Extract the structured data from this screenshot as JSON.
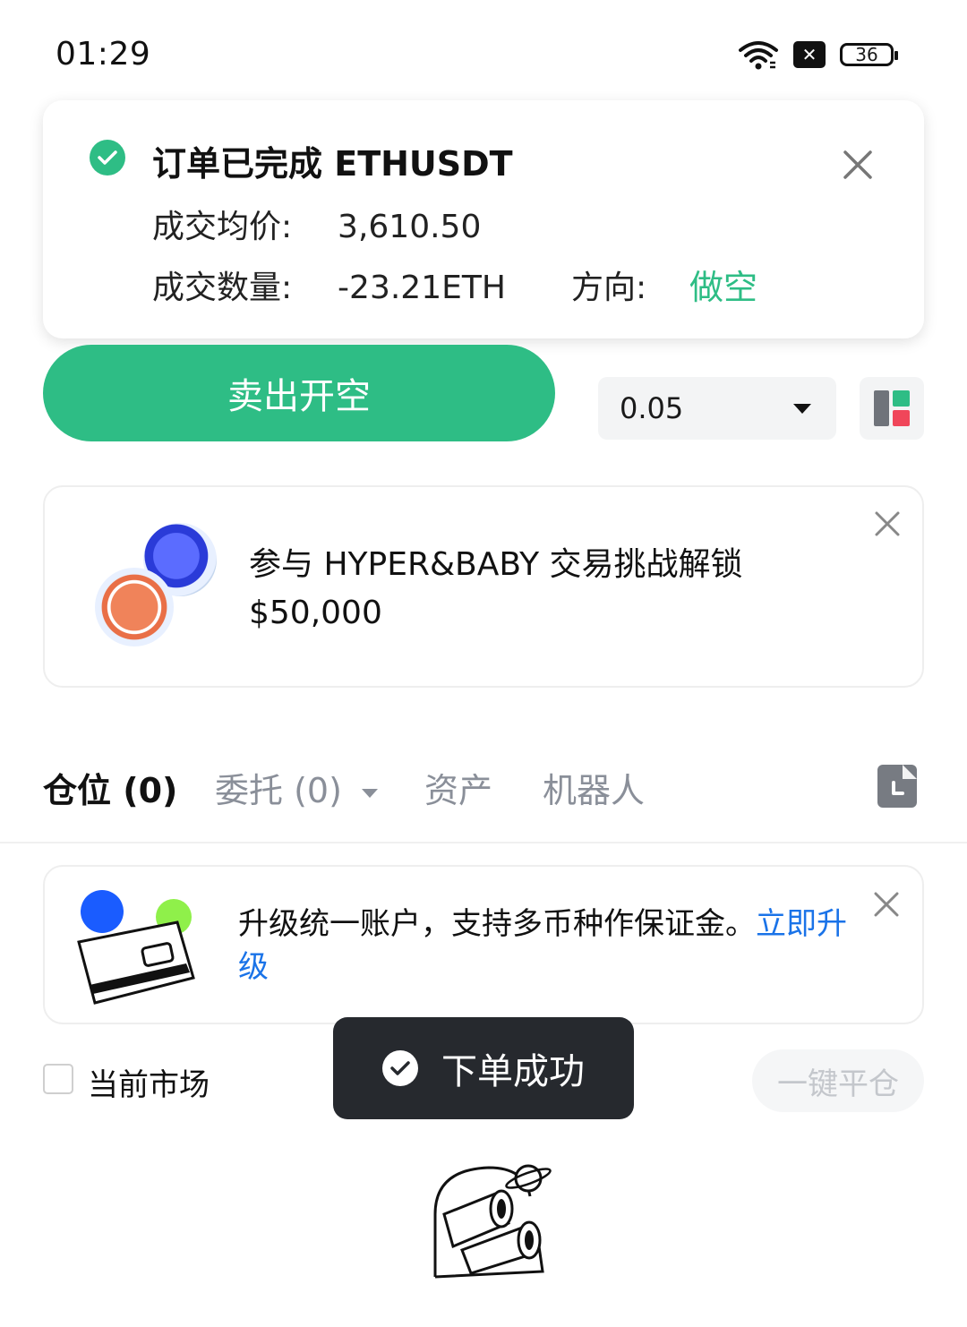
{
  "status_bar": {
    "time": "01:29",
    "battery": "36"
  },
  "order_toast": {
    "title": "订单已完成 ETHUSDT",
    "avg_price_label": "成交均价:",
    "avg_price": "3,610.50",
    "qty_label": "成交数量:",
    "qty": "-23.21ETH",
    "direction_label": "方向:",
    "direction": "做空"
  },
  "trade": {
    "sell_button": "卖出开空",
    "quantity_select": "0.05"
  },
  "promo": {
    "text": "参与 HYPER&BABY 交易挑战解锁 $50,000"
  },
  "tabs": [
    {
      "label": "仓位 (0)"
    },
    {
      "label": "委托 (0)"
    },
    {
      "label": "资产"
    },
    {
      "label": "机器人"
    }
  ],
  "upgrade": {
    "text": "升级统一账户，支持多币种作保证金。",
    "link": "立即升级"
  },
  "filters": {
    "current_market": "当前市场",
    "close_all": "一键平仓"
  },
  "toast": {
    "message": "下单成功"
  },
  "colors": {
    "accent_green": "#2ebd85",
    "link_blue": "#1a73e8",
    "toast_bg": "#26292e"
  }
}
